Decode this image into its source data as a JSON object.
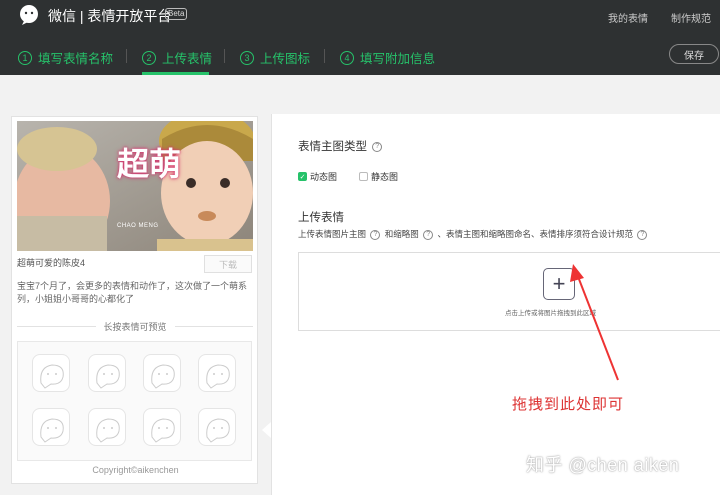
{
  "header": {
    "app_title": "微信 | 表情开放平台",
    "beta": "Beta",
    "links": {
      "my_emoji": "我的表情",
      "spec": "制作规范"
    },
    "save_label": "保存"
  },
  "steps": [
    {
      "num": "1",
      "label": "填写表情名称"
    },
    {
      "num": "2",
      "label": "上传表情"
    },
    {
      "num": "3",
      "label": "上传图标"
    },
    {
      "num": "4",
      "label": "填写附加信息"
    }
  ],
  "preview": {
    "banner_text_big": "超萌",
    "banner_text_small": "CHAO MENG",
    "name": "超萌可爱的陈皮4",
    "download_label": "下载",
    "description": "宝宝7个月了，会更多的表情和动作了，这次做了一个萌系列，小姐姐小哥哥的心都化了",
    "long_press_title": "长按表情可预览",
    "copyright": "Copyright©aikenchen"
  },
  "form": {
    "type_label": "表情主图类型",
    "types": [
      {
        "label": "动态图",
        "checked": true
      },
      {
        "label": "静态图",
        "checked": false
      }
    ],
    "upload_label": "上传表情",
    "upload_desc_part1": "上传表情图片主图",
    "upload_desc_part2": "和缩略图",
    "upload_desc_part3": "、表情主图和缩略图命名、表情排序须符合设计规范",
    "plus_symbol": "+",
    "drop_hint": "点击上传或将图片拖拽到此区域"
  },
  "annotation": "拖拽到此处即可",
  "watermark": "知乎 @chen aiken",
  "colors": {
    "accent": "#26c26a",
    "header_bg": "#2e3132",
    "annotation": "#dd3333"
  }
}
